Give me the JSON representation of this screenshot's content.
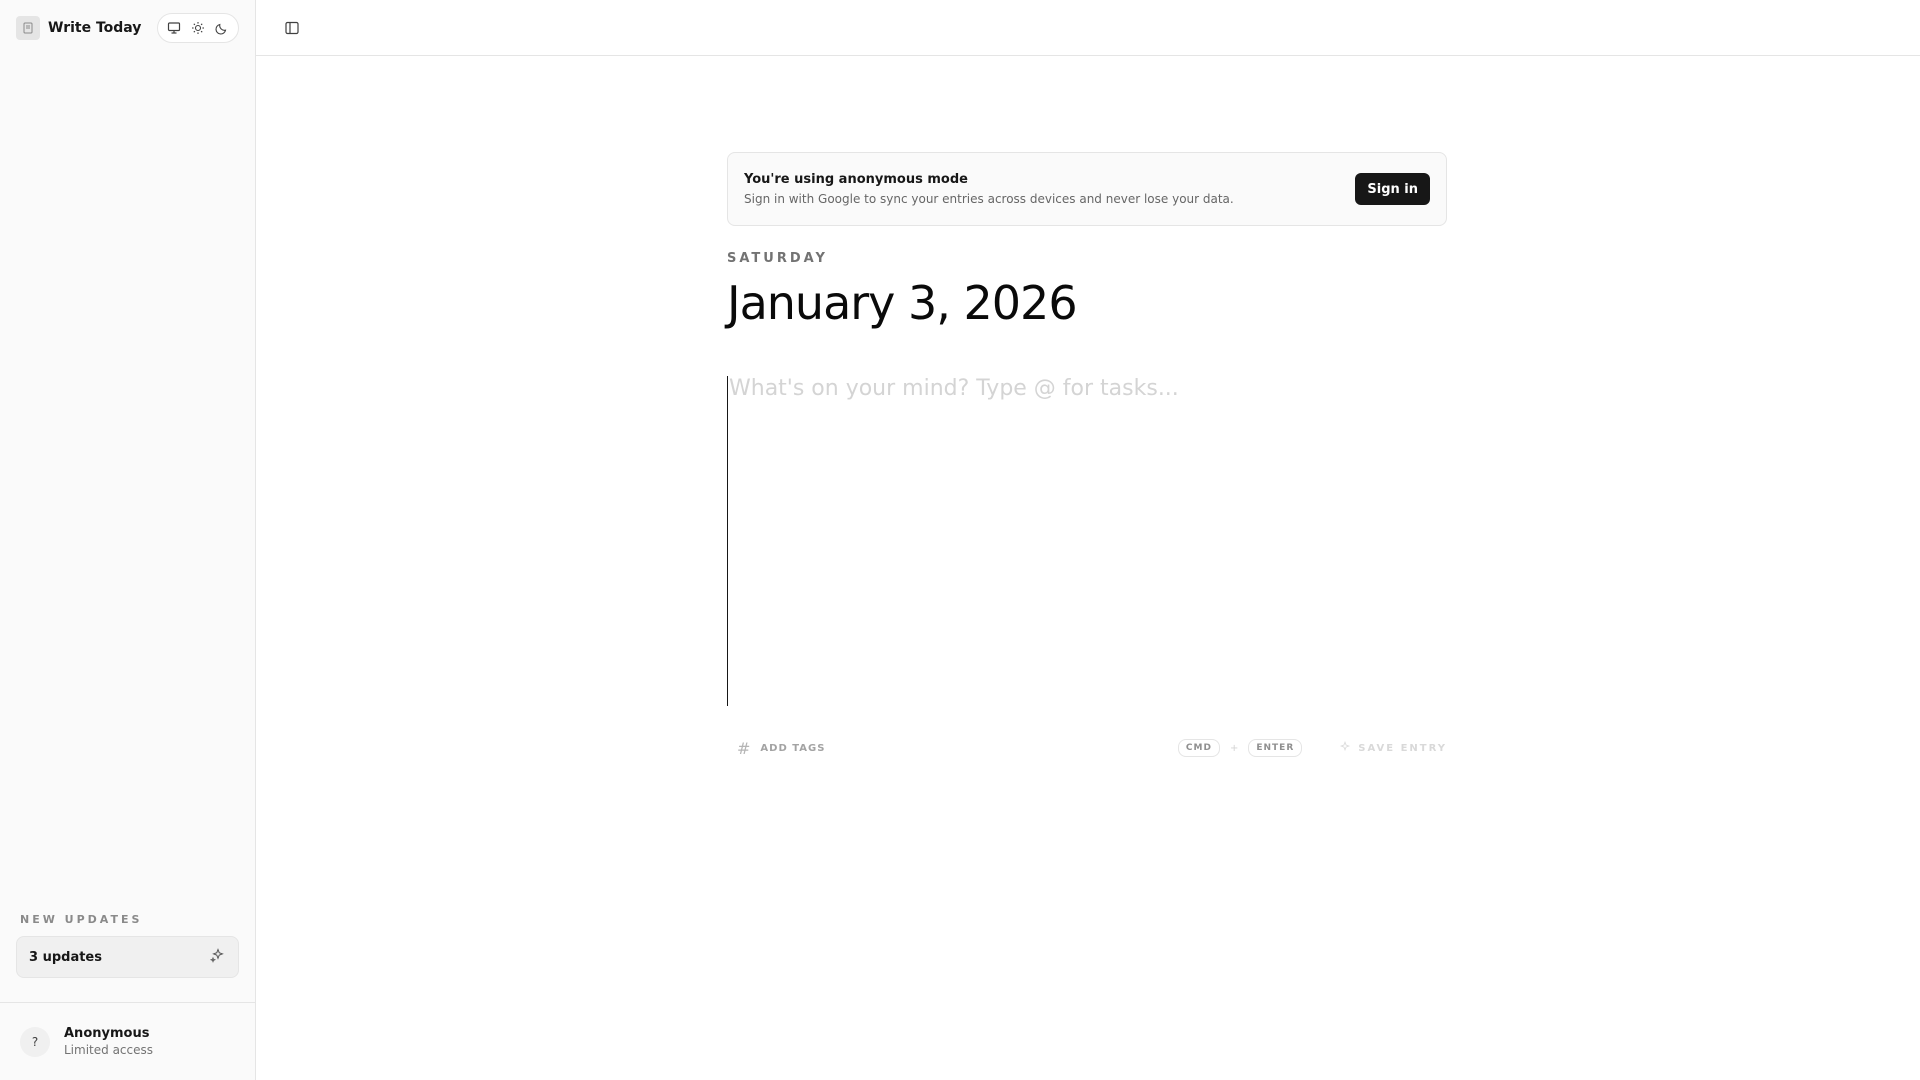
{
  "app": {
    "name": "Write Today"
  },
  "theme": {
    "options": [
      "system",
      "light",
      "dark"
    ]
  },
  "sidebar": {
    "updates_heading": "NEW UPDATES",
    "updates_label": "3 updates"
  },
  "user": {
    "initial": "?",
    "name": "Anonymous",
    "status": "Limited access"
  },
  "notice": {
    "title": "You're using anonymous mode",
    "description": "Sign in with Google to sync your entries across devices and never lose your data.",
    "button": "Sign in"
  },
  "entry": {
    "weekday": "SATURDAY",
    "date": "January 3, 2026",
    "placeholder": "What's on your mind? Type @ for tasks...",
    "value": ""
  },
  "footer": {
    "add_tags": "ADD TAGS",
    "shortcut_keys": [
      "CMD",
      "ENTER"
    ],
    "shortcut_sep": "+",
    "save_label": "SAVE ENTRY"
  },
  "colors": {
    "accent": "#171717",
    "sidebar_bg": "#fafafa",
    "border": "#e5e5e5"
  }
}
